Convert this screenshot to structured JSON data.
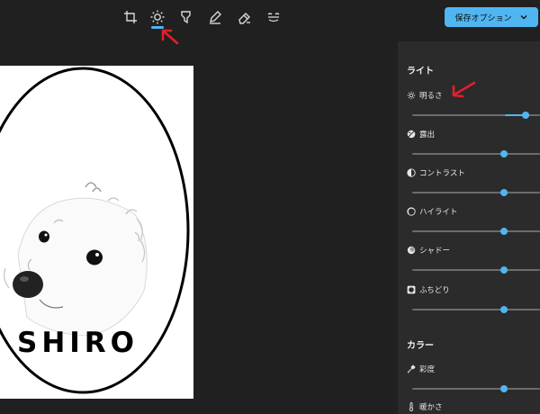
{
  "toolbar": {
    "tools": [
      {
        "icon": "crop-icon"
      },
      {
        "icon": "brightness-icon",
        "active": true
      },
      {
        "icon": "filter-icon"
      },
      {
        "icon": "markup-pen-icon"
      },
      {
        "icon": "retouch-eraser-icon"
      },
      {
        "icon": "red-eye-icon"
      }
    ],
    "save_label": "保存オプション"
  },
  "image": {
    "caption": "SHIRO"
  },
  "panel": {
    "light_title": "ライト",
    "light_items": [
      {
        "label": "明るさ",
        "icon": "brightness-icon",
        "value": 0.9
      },
      {
        "label": "露出",
        "icon": "exposure-icon",
        "value": 0.72
      },
      {
        "label": "コントラスト",
        "icon": "contrast-icon",
        "value": 0.72
      },
      {
        "label": "ハイライト",
        "icon": "highlight-icon",
        "value": 0.72
      },
      {
        "label": "シャドー",
        "icon": "shadow-icon",
        "value": 0.72
      },
      {
        "label": "ふちどり",
        "icon": "vignette-icon",
        "value": 0.72
      }
    ],
    "color_title": "カラー",
    "color_items": [
      {
        "label": "彩度",
        "icon": "saturation-dropper-icon",
        "value": 0.72
      },
      {
        "label": "暖かさ",
        "icon": "warmth-thermometer-icon",
        "value": 0.72
      }
    ]
  },
  "colors": {
    "accent": "#4fb6f2",
    "background": "#202020",
    "panel": "#2b2b2b",
    "annotation": "#e0202a"
  }
}
